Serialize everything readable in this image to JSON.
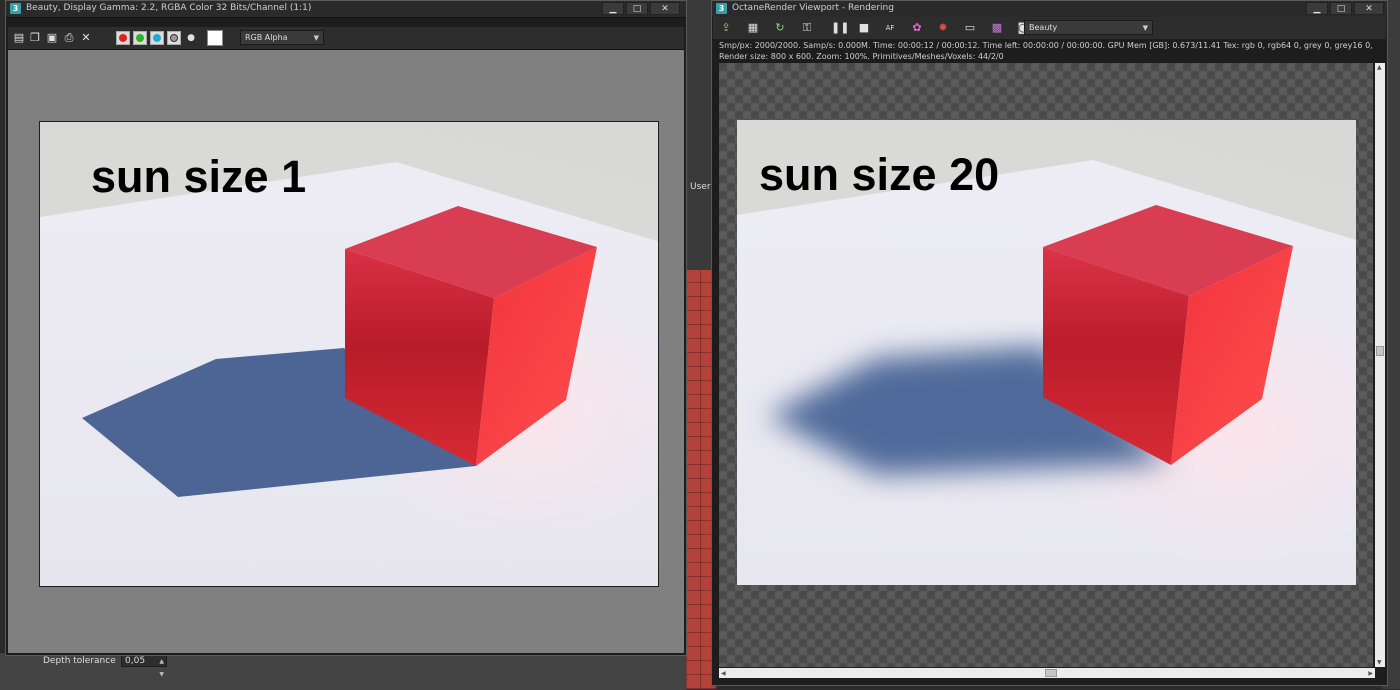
{
  "background": {
    "viewport_label": "User",
    "depth_tolerance_label": "Depth tolerance",
    "depth_tolerance_value": "0,05"
  },
  "left_window": {
    "app_icon": "3",
    "title": "Beauty, Display Gamma: 2.2, RGBA Color 32 Bits/Channel (1:1)",
    "controls": [
      "minimize-icon",
      "maximize-icon",
      "close-icon"
    ],
    "toolbar": {
      "icons": [
        "save-icon",
        "copy-icon",
        "clone-icon",
        "print-icon",
        "clear-icon"
      ],
      "channels": [
        {
          "name": "red-channel",
          "color": "#e2221c"
        },
        {
          "name": "green-channel",
          "color": "#2bb12b"
        },
        {
          "name": "blue-channel",
          "color": "#20a8d8"
        },
        {
          "name": "mono-channel",
          "color": "#9a9a9a"
        }
      ],
      "alpha_dot": "●",
      "channel_select": "RGB Alpha"
    },
    "caption": "sun size 1"
  },
  "right_window": {
    "app_icon": "3",
    "title": "OctaneRender Viewport - Rendering",
    "controls": [
      "minimize-icon",
      "maximize-icon",
      "close-icon"
    ],
    "toolbar": {
      "icons": [
        "send-scene-icon",
        "rebuild-icon",
        "restart-icon",
        "lock-icon",
        "pause-icon",
        "stop-icon",
        "af-icon",
        "color-icon",
        "region-icon",
        "settings-icon",
        "palette-icon",
        "camera-icon"
      ],
      "pass_select": "Beauty"
    },
    "status": {
      "line1": "Smp/px: 2000/2000.   Samp/s: 0.000M.   Time: 00:00:12 / 00:00:12.   Time left: 00:00:00 / 00:00:00.   GPU Mem [GB]: 0.673/11.41   Tex: rgb 0, rgb64 0, grey 0, grey16 0,",
      "line2": "Render size: 800 x 600.   Zoom: 100%.   Primitives/Meshes/Voxels: 44/2/0"
    },
    "caption": "sun size 20"
  },
  "colors": {
    "cube_top": "#d93d52",
    "cube_left": "#c4202e",
    "cube_right": "#f43c42",
    "shadow": "#4d6694",
    "floor": "#ecebf3",
    "wall": "#d8d8d6"
  }
}
